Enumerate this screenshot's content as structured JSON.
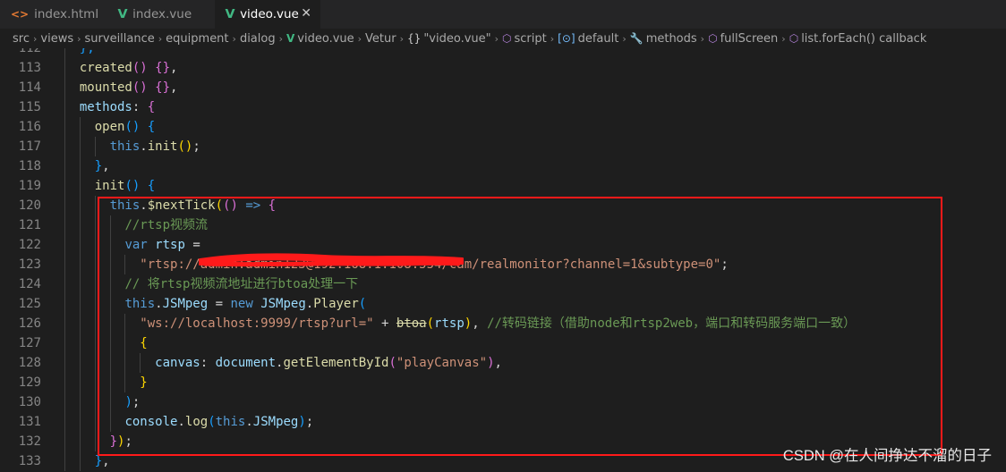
{
  "tabs": [
    {
      "label": "index.html",
      "icon": "html-file-icon",
      "active": false
    },
    {
      "label": "index.vue",
      "icon": "vue-file-icon",
      "active": false
    },
    {
      "label": "video.vue",
      "icon": "vue-file-icon",
      "active": true
    }
  ],
  "tab_close": "✕",
  "breadcrumb": [
    {
      "label": "src",
      "icon": ""
    },
    {
      "label": "views",
      "icon": ""
    },
    {
      "label": "surveillance",
      "icon": ""
    },
    {
      "label": "equipment",
      "icon": ""
    },
    {
      "label": "dialog",
      "icon": ""
    },
    {
      "label": "video.vue",
      "icon": "vue-file-icon"
    },
    {
      "label": "Vetur",
      "icon": ""
    },
    {
      "label": "\"video.vue\"",
      "icon": "braces-icon"
    },
    {
      "label": "script",
      "icon": "module-icon"
    },
    {
      "label": "default",
      "icon": "field-icon"
    },
    {
      "label": "methods",
      "icon": "wrench-icon"
    },
    {
      "label": "fullScreen",
      "icon": "method-icon"
    },
    {
      "label": "list.forEach() callback",
      "icon": "method-icon"
    }
  ],
  "code_lines": [
    {
      "n": "112",
      "indent": 1,
      "tokens": [
        [
          "b3",
          "},"
        ]
      ]
    },
    {
      "n": "113",
      "indent": 1,
      "tokens": [
        [
          "fn",
          "created"
        ],
        [
          "b2",
          "()"
        ],
        [
          "pl",
          " "
        ],
        [
          "b2",
          "{}"
        ],
        [
          "pl",
          ","
        ]
      ]
    },
    {
      "n": "114",
      "indent": 1,
      "tokens": [
        [
          "fn",
          "mounted"
        ],
        [
          "b2",
          "()"
        ],
        [
          "pl",
          " "
        ],
        [
          "b2",
          "{}"
        ],
        [
          "pl",
          ","
        ]
      ]
    },
    {
      "n": "115",
      "indent": 1,
      "tokens": [
        [
          "var",
          "methods"
        ],
        [
          "pl",
          ": "
        ],
        [
          "b2",
          "{"
        ]
      ]
    },
    {
      "n": "116",
      "indent": 2,
      "tokens": [
        [
          "fn",
          "open"
        ],
        [
          "b3",
          "()"
        ],
        [
          "pl",
          " "
        ],
        [
          "b3",
          "{"
        ]
      ]
    },
    {
      "n": "117",
      "indent": 3,
      "tokens": [
        [
          "kw",
          "this"
        ],
        [
          "pl",
          "."
        ],
        [
          "fn",
          "init"
        ],
        [
          "b1",
          "()"
        ],
        [
          "pl",
          ";"
        ]
      ]
    },
    {
      "n": "118",
      "indent": 2,
      "tokens": [
        [
          "b3",
          "}"
        ],
        [
          "pl",
          ","
        ]
      ]
    },
    {
      "n": "119",
      "indent": 2,
      "tokens": [
        [
          "fn",
          "init"
        ],
        [
          "b3",
          "()"
        ],
        [
          "pl",
          " "
        ],
        [
          "b3",
          "{"
        ]
      ]
    },
    {
      "n": "120",
      "indent": 3,
      "tokens": [
        [
          "kw",
          "this"
        ],
        [
          "pl",
          "."
        ],
        [
          "fn",
          "$nextTick"
        ],
        [
          "b1",
          "("
        ],
        [
          "b2",
          "()"
        ],
        [
          "pl",
          " "
        ],
        [
          "kw",
          "=>"
        ],
        [
          "pl",
          " "
        ],
        [
          "b2",
          "{"
        ]
      ]
    },
    {
      "n": "121",
      "indent": 4,
      "tokens": [
        [
          "cmt",
          "//rtsp视频流"
        ]
      ]
    },
    {
      "n": "122",
      "indent": 4,
      "tokens": [
        [
          "kw",
          "var"
        ],
        [
          "pl",
          " "
        ],
        [
          "var",
          "rtsp"
        ],
        [
          "pl",
          " ="
        ]
      ]
    },
    {
      "n": "123",
      "indent": 5,
      "tokens": [
        [
          "str",
          "\"rtsp://admin:admin123@192.168.1.108:554/cam/realmonitor?channel=1&subtype=0\""
        ],
        [
          "pl",
          ";"
        ]
      ]
    },
    {
      "n": "124",
      "indent": 4,
      "tokens": [
        [
          "cmt",
          "// 将rtsp视频流地址进行btoa处理一下"
        ]
      ]
    },
    {
      "n": "125",
      "indent": 4,
      "tokens": [
        [
          "kw",
          "this"
        ],
        [
          "pl",
          "."
        ],
        [
          "var",
          "JSMpeg"
        ],
        [
          "pl",
          " = "
        ],
        [
          "kw",
          "new"
        ],
        [
          "pl",
          " "
        ],
        [
          "var",
          "JSMpeg"
        ],
        [
          "pl",
          "."
        ],
        [
          "fn",
          "Player"
        ],
        [
          "b3",
          "("
        ]
      ]
    },
    {
      "n": "126",
      "indent": 5,
      "tokens": [
        [
          "str",
          "\"ws://localhost:9999/rtsp?url=\""
        ],
        [
          "pl",
          " + "
        ],
        [
          "fns",
          "btoa"
        ],
        [
          "b1",
          "("
        ],
        [
          "var",
          "rtsp"
        ],
        [
          "b1",
          ")"
        ],
        [
          "pl",
          ", "
        ],
        [
          "cmt",
          "//转码链接（借助node和rtsp2web，端口和转码服务端口一致）"
        ]
      ]
    },
    {
      "n": "127",
      "indent": 5,
      "tokens": [
        [
          "b1",
          "{"
        ]
      ]
    },
    {
      "n": "128",
      "indent": 6,
      "tokens": [
        [
          "var",
          "canvas"
        ],
        [
          "pl",
          ": "
        ],
        [
          "var",
          "document"
        ],
        [
          "pl",
          "."
        ],
        [
          "fn",
          "getElementById"
        ],
        [
          "b2",
          "("
        ],
        [
          "str",
          "\"playCanvas\""
        ],
        [
          "b2",
          ")"
        ],
        [
          "pl",
          ","
        ]
      ]
    },
    {
      "n": "129",
      "indent": 5,
      "tokens": [
        [
          "b1",
          "}"
        ]
      ]
    },
    {
      "n": "130",
      "indent": 4,
      "tokens": [
        [
          "b3",
          ")"
        ],
        [
          "pl",
          ";"
        ]
      ]
    },
    {
      "n": "131",
      "indent": 4,
      "tokens": [
        [
          "var",
          "console"
        ],
        [
          "pl",
          "."
        ],
        [
          "fn",
          "log"
        ],
        [
          "b3",
          "("
        ],
        [
          "kw",
          "this"
        ],
        [
          "pl",
          "."
        ],
        [
          "var",
          "JSMpeg"
        ],
        [
          "b3",
          ")"
        ],
        [
          "pl",
          ";"
        ]
      ]
    },
    {
      "n": "132",
      "indent": 3,
      "tokens": [
        [
          "b2",
          "}"
        ],
        [
          "b1",
          ")"
        ],
        [
          "pl",
          ";"
        ]
      ]
    },
    {
      "n": "133",
      "indent": 2,
      "tokens": [
        [
          "b3",
          "}"
        ],
        [
          "pl",
          ","
        ]
      ]
    }
  ],
  "watermark": "CSDN @在人间挣达不溜的日子",
  "colors": {
    "annotation_box": "#ff1a1a",
    "redaction": "#ff1a1a"
  }
}
